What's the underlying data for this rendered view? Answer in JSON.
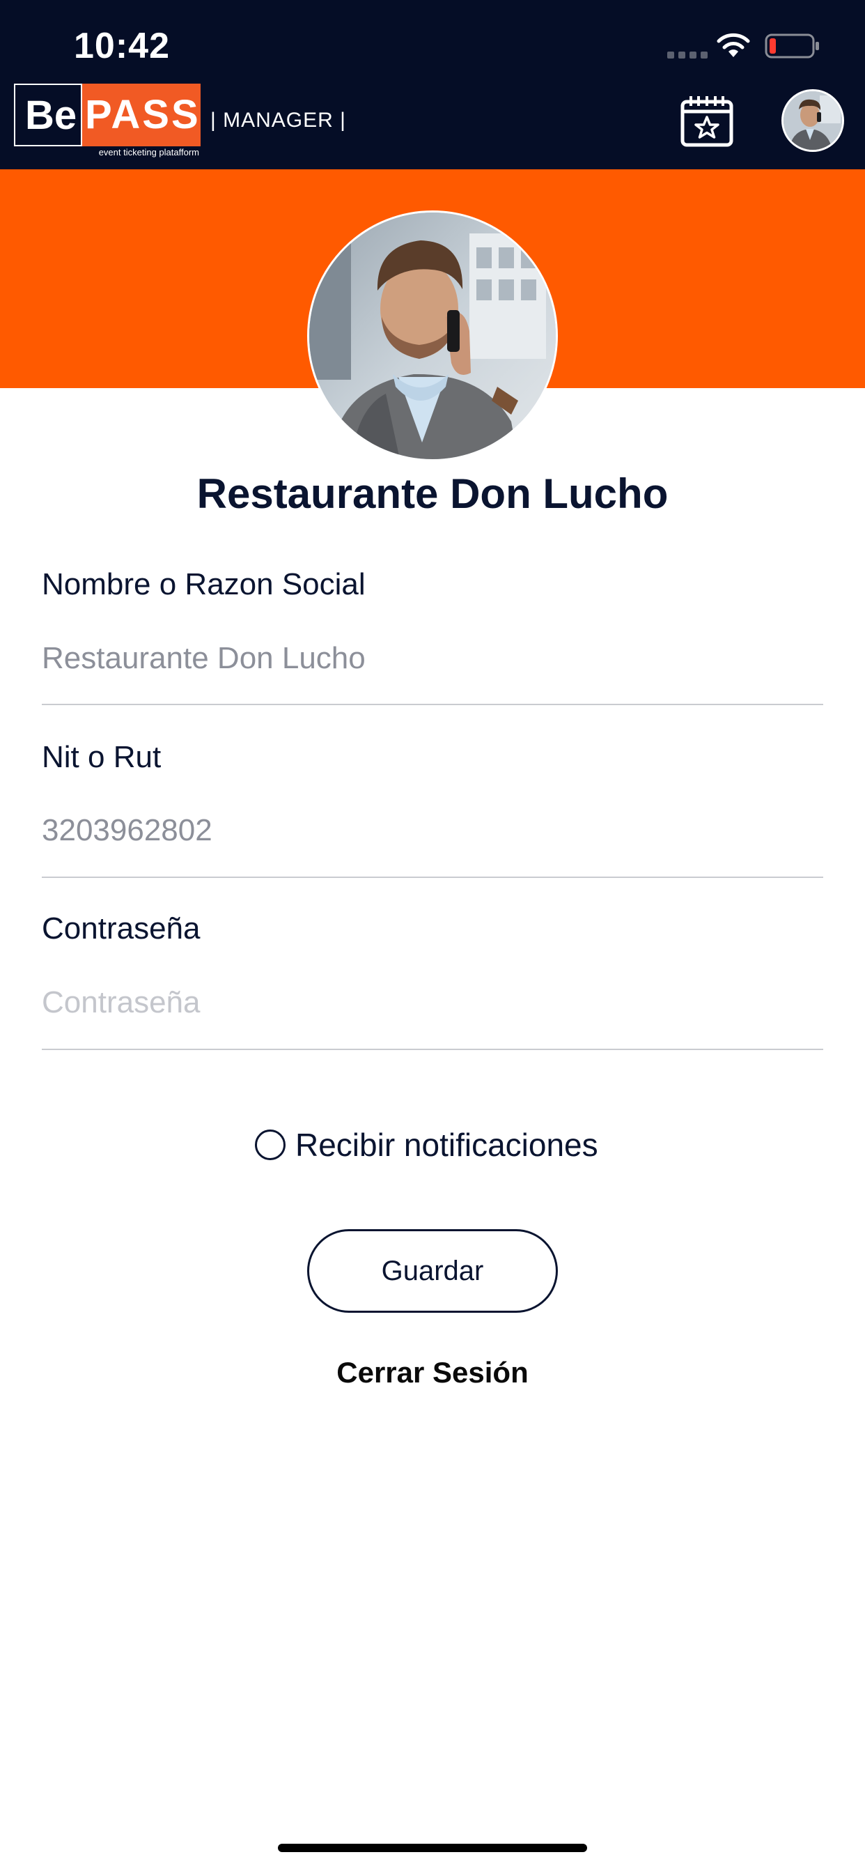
{
  "status_bar": {
    "time": "10:42"
  },
  "header": {
    "logo": {
      "be": "Be",
      "pass": "PASS",
      "tagline": "event ticketing platafform"
    },
    "section_label": "| MANAGER |",
    "calendar_icon": "calendar-star-icon",
    "avatar_icon": "user-avatar"
  },
  "profile": {
    "name": "Restaurante Don Lucho"
  },
  "form": {
    "fields": [
      {
        "label": "Nombre o Razon Social",
        "value": "Restaurante Don Lucho",
        "placeholder": ""
      },
      {
        "label": "Nit o Rut",
        "value": "3203962802",
        "placeholder": ""
      },
      {
        "label": "Contraseña",
        "value": "",
        "placeholder": "Contraseña"
      }
    ],
    "notifications_label": "Recibir notificaciones",
    "notifications_checked": false,
    "save_label": "Guardar",
    "logout_label": "Cerrar Sesión"
  },
  "colors": {
    "header_bg": "#050d26",
    "accent": "#ff5a00",
    "text_dark": "#0a1430"
  }
}
